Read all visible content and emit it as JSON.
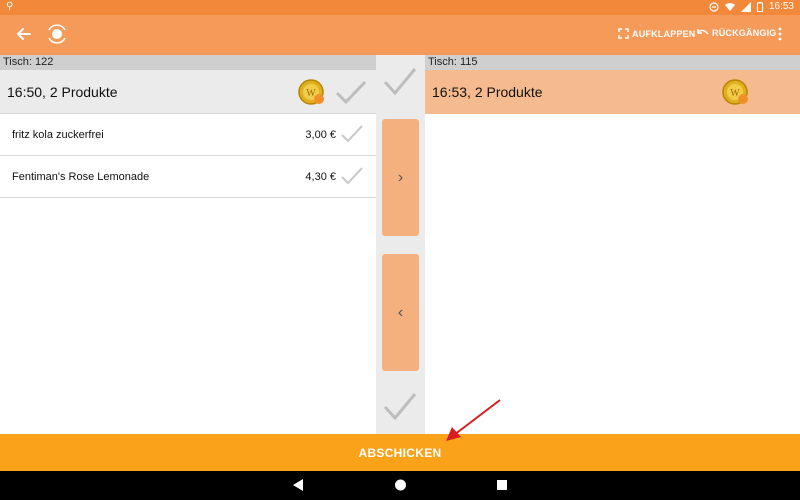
{
  "statusbar": {
    "time": "16:53"
  },
  "appbar": {
    "expand_label": "AUFKLAPPEN",
    "undo_label": "RÜCKGÄNGIG"
  },
  "left_panel": {
    "table_label": "Tisch: 122",
    "order_summary": "16:50, 2 Produkte",
    "items": [
      {
        "name": "fritz kola zuckerfrei",
        "price": "3,00 €"
      },
      {
        "name": "Fentiman's Rose Lemonade",
        "price": "4,30 €"
      }
    ]
  },
  "right_panel": {
    "table_label": "Tisch: 115",
    "order_summary": "16:53, 2 Produkte"
  },
  "middle": {
    "move_right_glyph": "›",
    "move_left_glyph": "‹"
  },
  "footer": {
    "submit_label": "ABSCHICKEN"
  },
  "colors": {
    "statusbar": "#f2883a",
    "appbar": "#f59a58",
    "selected_order": "#f5bb8f",
    "submit": "#f9a21a",
    "arrow_button": "#f4b07e"
  },
  "icons": [
    "back-arrow-icon",
    "app-logo-icon",
    "expand-icon",
    "undo-icon",
    "more-vert-icon",
    "coin-icon",
    "checkmark-icon",
    "nav-back-icon",
    "nav-home-icon",
    "nav-recents-icon"
  ]
}
